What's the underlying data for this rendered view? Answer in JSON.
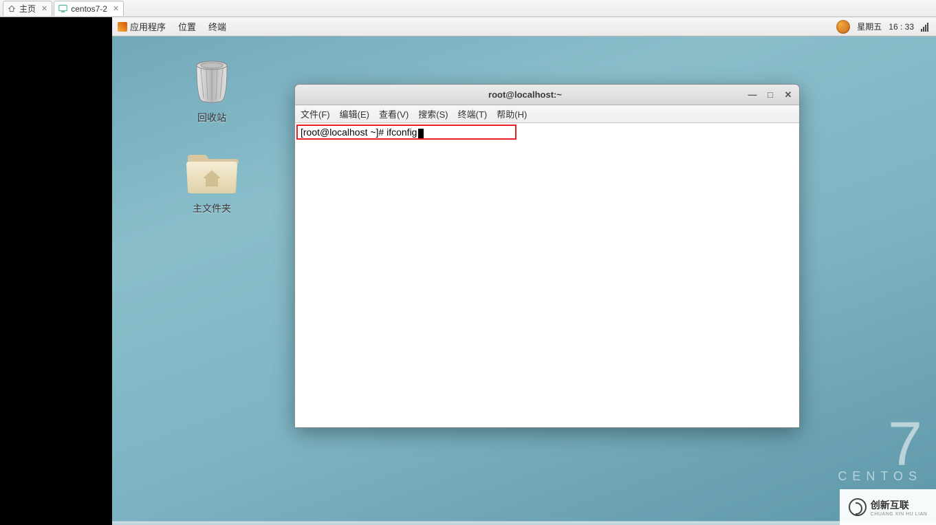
{
  "vm_tabs": {
    "home": "主页",
    "active": "centos7-2"
  },
  "gnome_panel": {
    "apps": "应用程序",
    "places": "位置",
    "terminal": "终端",
    "day_label": "星期五",
    "time": "16 : 33"
  },
  "desktop_icons": {
    "trash": "回收站",
    "home_folder": "主文件夹"
  },
  "terminal": {
    "title": "root@localhost:~",
    "menu": {
      "file": "文件(F)",
      "edit": "编辑(E)",
      "view": "查看(V)",
      "search": "搜索(S)",
      "terminal": "终端(T)",
      "help": "帮助(H)"
    },
    "prompt": "[root@localhost ~]# ifconfig"
  },
  "branding": {
    "number": "7",
    "name": "CENTOS"
  },
  "watermark": {
    "text": "创新互联",
    "sub": "CHUANG XIN HU LIAN"
  }
}
